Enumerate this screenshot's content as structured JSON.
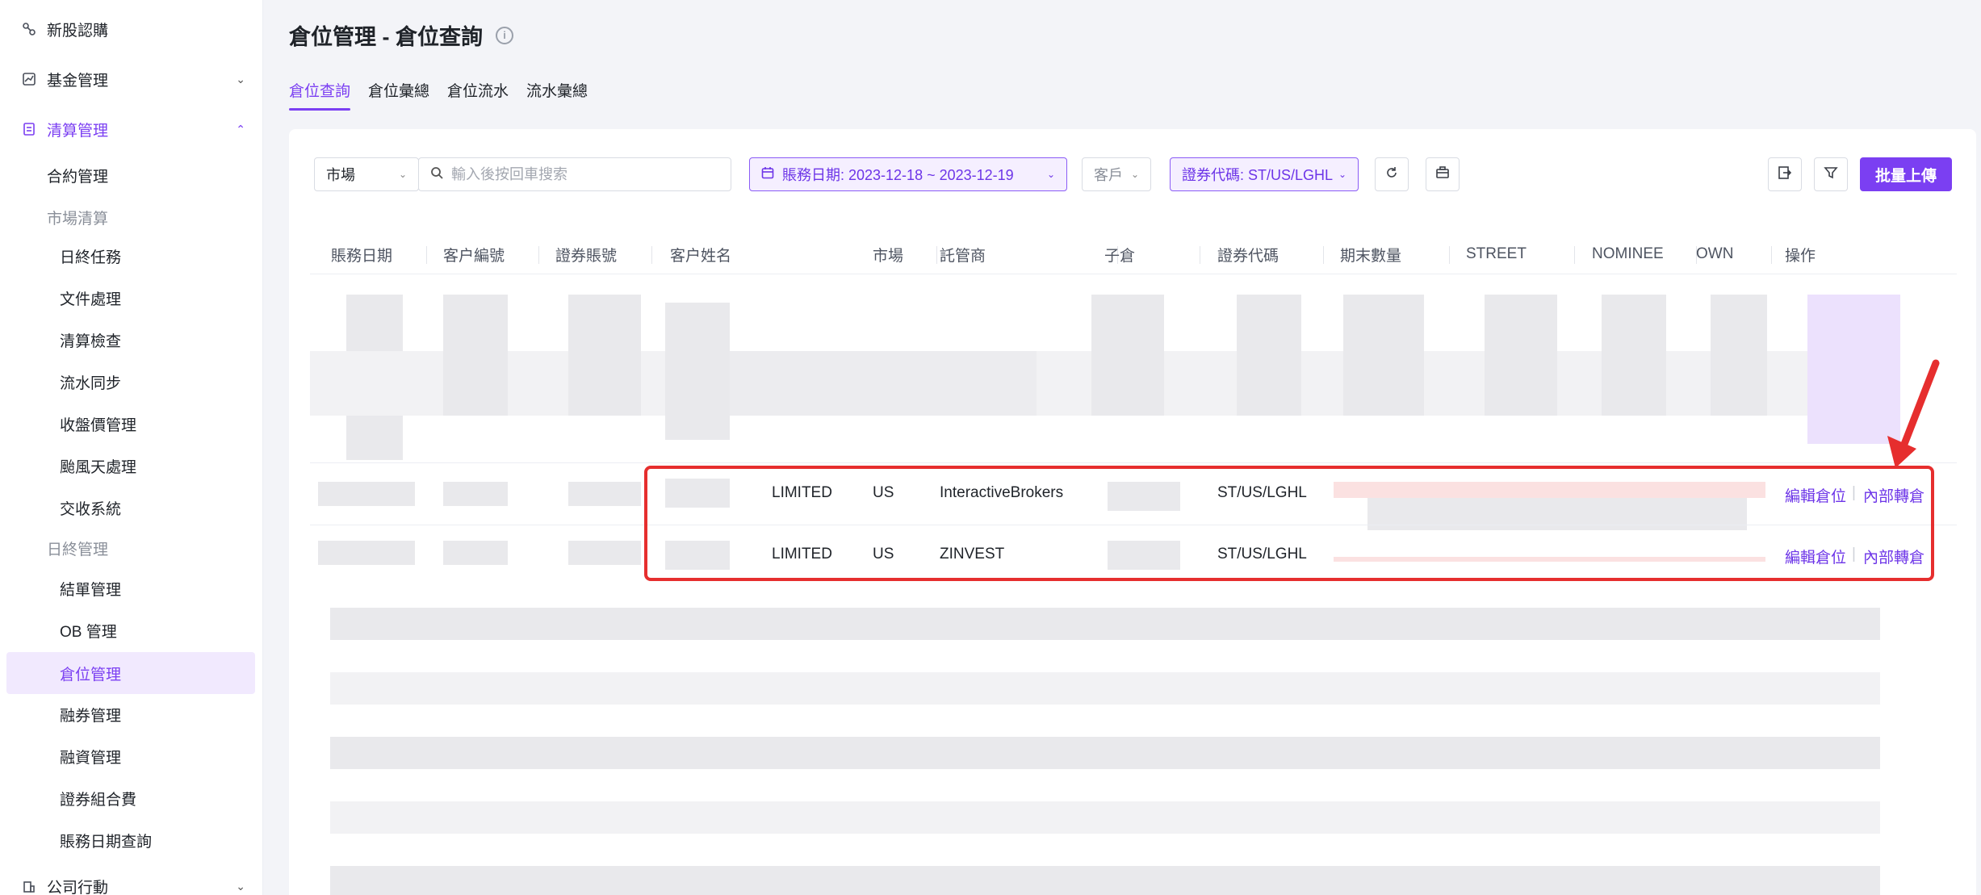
{
  "sidebar": {
    "items": [
      {
        "label": "新股認購"
      },
      {
        "label": "基金管理"
      },
      {
        "label": "清算管理"
      },
      {
        "label": "公司行動"
      }
    ],
    "clearing": {
      "contract": "合約管理",
      "market_group": "市場清算",
      "market_items": [
        "日終任務",
        "文件處理",
        "清算檢查",
        "流水同步",
        "收盤價管理",
        "颱風天處理",
        "交收系統"
      ],
      "eod_group": "日終管理",
      "eod_items": [
        "結單管理",
        "OB 管理",
        "倉位管理",
        "融券管理",
        "融資管理",
        "證券組合費",
        "賬務日期查詢"
      ]
    }
  },
  "header": {
    "title": "倉位管理 - 倉位查詢",
    "info_glyph": "i",
    "tabs": [
      "倉位查詢",
      "倉位彙總",
      "倉位流水",
      "流水彙總"
    ]
  },
  "toolbar": {
    "market_select": "市場",
    "search_placeholder": "輸入後按回車搜索",
    "date_range": "賬務日期: 2023-12-18 ~ 2023-12-19",
    "client_select": "客戶",
    "security_code": "證券代碼: ST/US/LGHL",
    "bulk_upload": "批量上傳"
  },
  "table": {
    "columns": [
      "賬務日期",
      "客户編號",
      "證券賬號",
      "客户姓名",
      "市場",
      "託管商",
      "子倉",
      "證券代碼",
      "期末數量",
      "STREET",
      "NOMINEE",
      "OWN",
      "操作"
    ],
    "rows": [
      {
        "name": "LIMITED",
        "market": "US",
        "custodian": "InteractiveBrokers",
        "code": "ST/US/LGHL",
        "action_edit": "編輯倉位",
        "action_sep": "|",
        "action_transfer": "內部轉倉"
      },
      {
        "name": "LIMITED",
        "market": "US",
        "custodian": "ZINVEST",
        "code": "ST/US/LGHL",
        "action_edit": "編輯倉位",
        "action_sep": "|",
        "action_transfer": "內部轉倉"
      }
    ]
  },
  "colors": {
    "accent": "#7b3ff2",
    "highlight": "#e62e2e"
  }
}
